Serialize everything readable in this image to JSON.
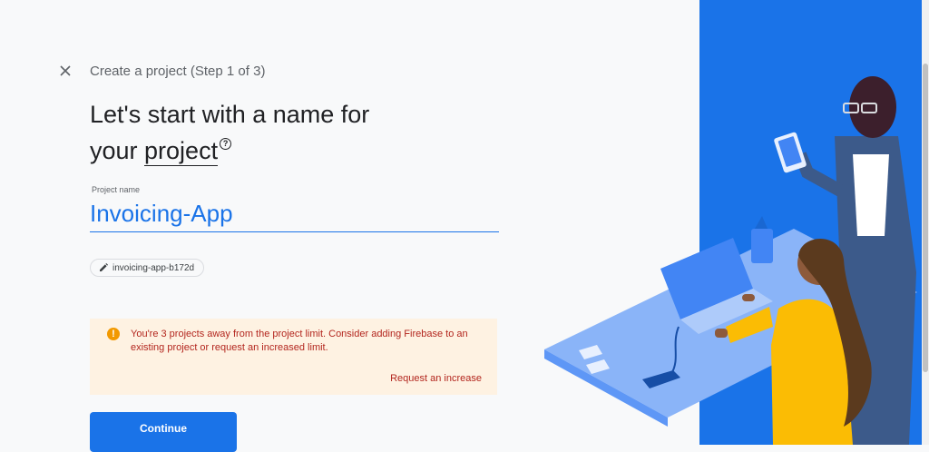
{
  "header": {
    "close_icon": "close-icon",
    "step_label": "Create a project (Step 1 of 3)"
  },
  "headline": {
    "line1": "Let's start with a name for",
    "line2_prefix": "your ",
    "line2_underlined": "project",
    "help_icon": "help-circle-icon",
    "help_glyph": "?"
  },
  "project_name": {
    "label": "Project name",
    "value": "Invoicing-App"
  },
  "project_id_chip": {
    "icon": "pencil-icon",
    "value": "invoicing-app-b172d"
  },
  "warning": {
    "icon": "warning-icon",
    "icon_glyph": "!",
    "message": "You're 3 projects away from the project limit. Consider adding Firebase to an existing project or request an increased limit.",
    "link": "Request an increase"
  },
  "continue_label": "Continue",
  "colors": {
    "accent": "#1a73e8",
    "warning_bg": "#fef2e2",
    "warning_text": "#b3261e",
    "warning_icon": "#f29900",
    "illustration_bg": "#1a73e8"
  }
}
